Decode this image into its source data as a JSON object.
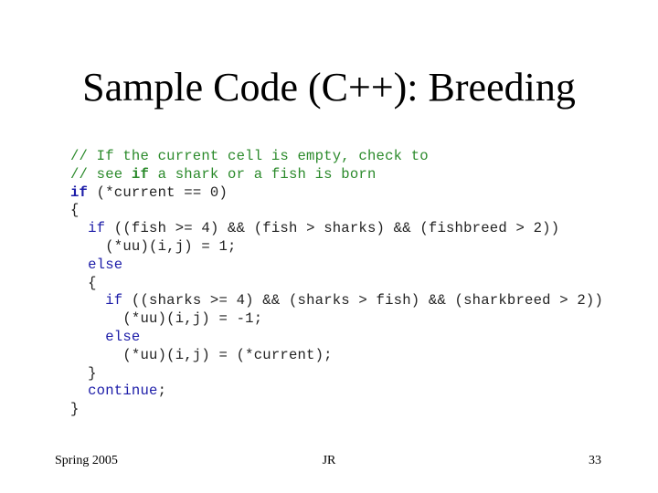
{
  "slide": {
    "title": "Sample Code (C++): Breeding",
    "footer": {
      "left": "Spring 2005",
      "center": "JR",
      "right": "33"
    }
  },
  "colors": {
    "comment": "#2b8a2b",
    "keyword": "#1c1ca8",
    "plain": "#222222"
  },
  "code": {
    "language": "C++",
    "lines": [
      [
        {
          "t": "// If the current cell is empty, check to",
          "k": "comment"
        }
      ],
      [
        {
          "t": "// see ",
          "k": "comment"
        },
        {
          "t": "if",
          "k": "comment-bold"
        },
        {
          "t": " a shark or a fish is born",
          "k": "comment"
        }
      ],
      [
        {
          "t": "if",
          "k": "keyword-bold"
        },
        {
          "t": " (*current == 0)",
          "k": "plain"
        }
      ],
      [
        {
          "t": "{",
          "k": "plain"
        }
      ],
      [
        {
          "t": "  ",
          "k": "plain"
        },
        {
          "t": "if",
          "k": "keyword"
        },
        {
          "t": " ((fish >= 4) && (fish > sharks) && (fishbreed > 2))",
          "k": "plain"
        }
      ],
      [
        {
          "t": "    (*uu)(i,j) = 1;",
          "k": "plain"
        }
      ],
      [
        {
          "t": "  ",
          "k": "plain"
        },
        {
          "t": "else",
          "k": "keyword"
        }
      ],
      [
        {
          "t": "  {",
          "k": "plain"
        }
      ],
      [
        {
          "t": "    ",
          "k": "plain"
        },
        {
          "t": "if",
          "k": "keyword"
        },
        {
          "t": " ((sharks >= 4) && (sharks > fish) && (sharkbreed > 2))",
          "k": "plain"
        }
      ],
      [
        {
          "t": "      (*uu)(i,j) = -1;",
          "k": "plain"
        }
      ],
      [
        {
          "t": "    ",
          "k": "plain"
        },
        {
          "t": "else",
          "k": "keyword"
        }
      ],
      [
        {
          "t": "      (*uu)(i,j) = (*current);",
          "k": "plain"
        }
      ],
      [
        {
          "t": "  }",
          "k": "plain"
        }
      ],
      [
        {
          "t": "  ",
          "k": "plain"
        },
        {
          "t": "continue",
          "k": "keyword"
        },
        {
          "t": ";",
          "k": "plain"
        }
      ],
      [
        {
          "t": "}",
          "k": "plain"
        }
      ]
    ]
  }
}
